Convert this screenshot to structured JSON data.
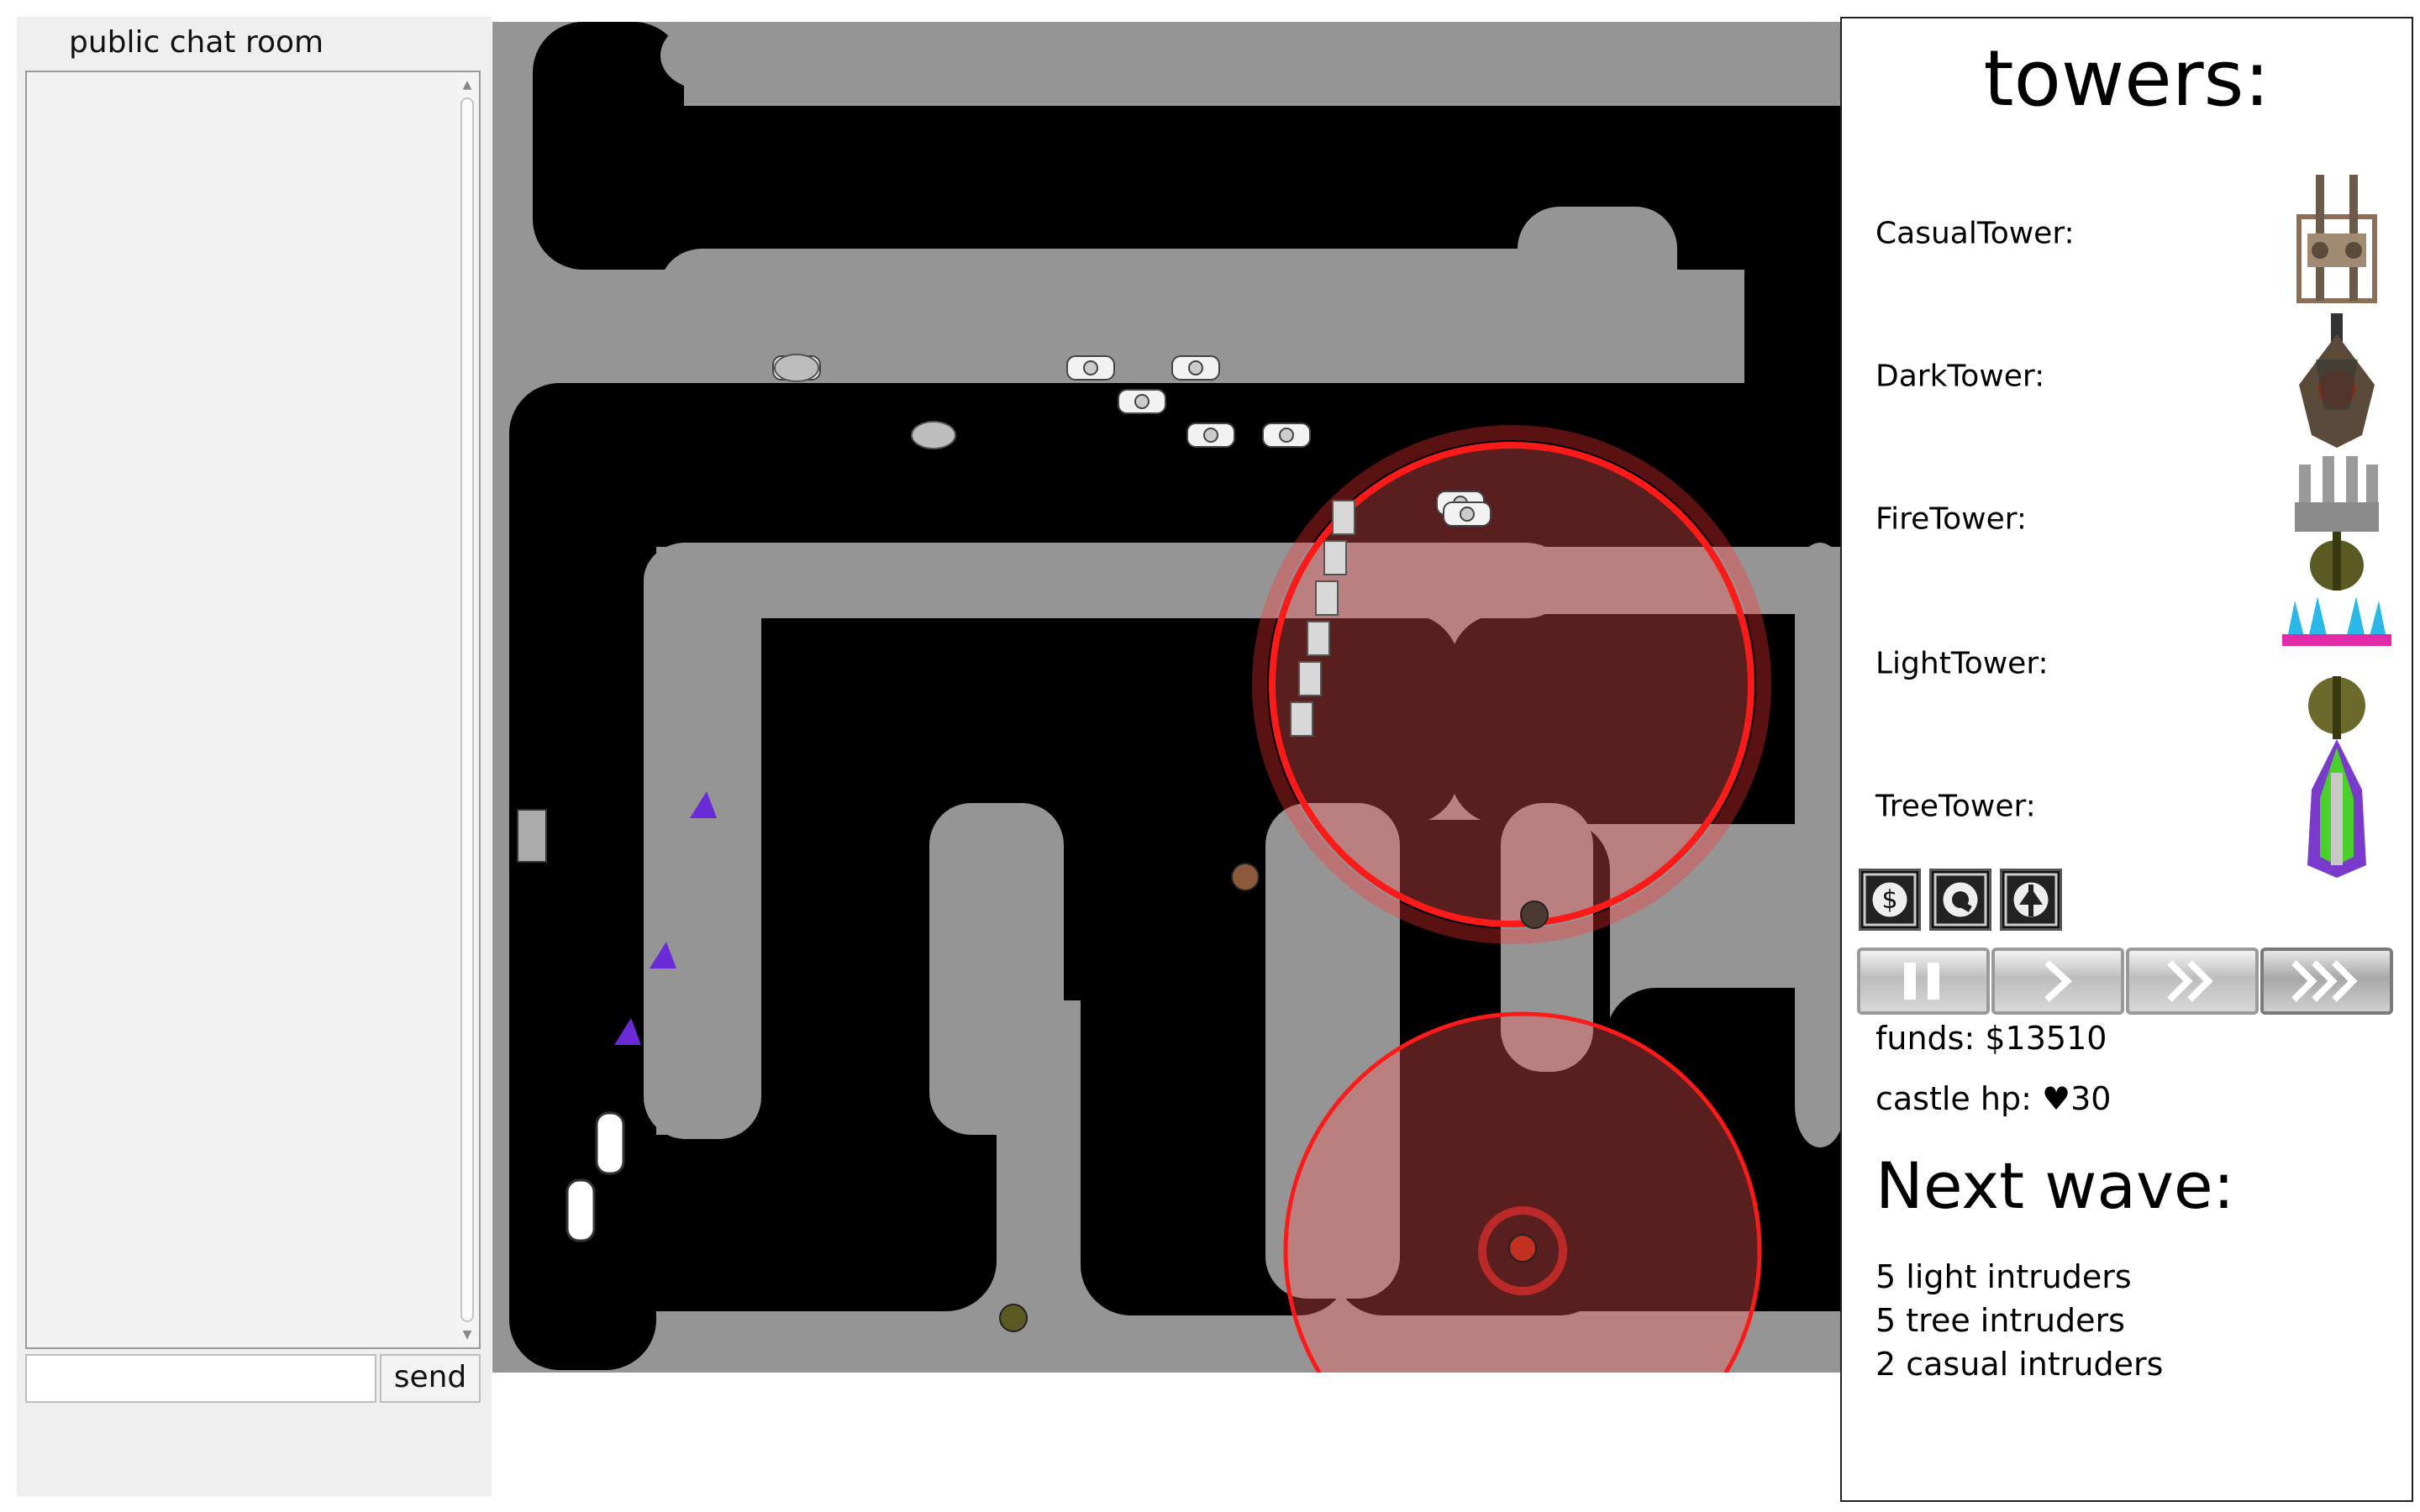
{
  "chat": {
    "title": "public chat room",
    "input_value": "",
    "send_label": "send"
  },
  "sidebar": {
    "title": "towers:",
    "towers": [
      {
        "label": "CasualTower:",
        "icon": "casual-tower-icon"
      },
      {
        "label": "DarkTower:",
        "icon": "dark-tower-icon"
      },
      {
        "label": "FireTower:",
        "icon": "fire-tower-icon"
      },
      {
        "label": "LightTower:",
        "icon": "light-tower-icon"
      },
      {
        "label": "TreeTower:",
        "icon": "tree-tower-icon"
      }
    ],
    "action_buttons": [
      "sell-icon",
      "upgrade-icon",
      "info-icon"
    ],
    "speed_controls": [
      "pause-icon",
      "speed-1x-icon",
      "speed-2x-icon",
      "speed-3x-icon"
    ],
    "active_speed": "speed-3x",
    "funds_label": "funds:",
    "funds_value": "$13510",
    "castle_hp_label": "castle hp:",
    "castle_hp_value": "30",
    "next_wave_title": "Next wave:",
    "next_wave": [
      "5 light intruders",
      "5 tree intruders",
      "2 casual intruders"
    ]
  },
  "colors": {
    "map_background": "#959595",
    "road": "#000000",
    "range_ring": "#ff2020",
    "range_fill": "#ff5a5a"
  }
}
